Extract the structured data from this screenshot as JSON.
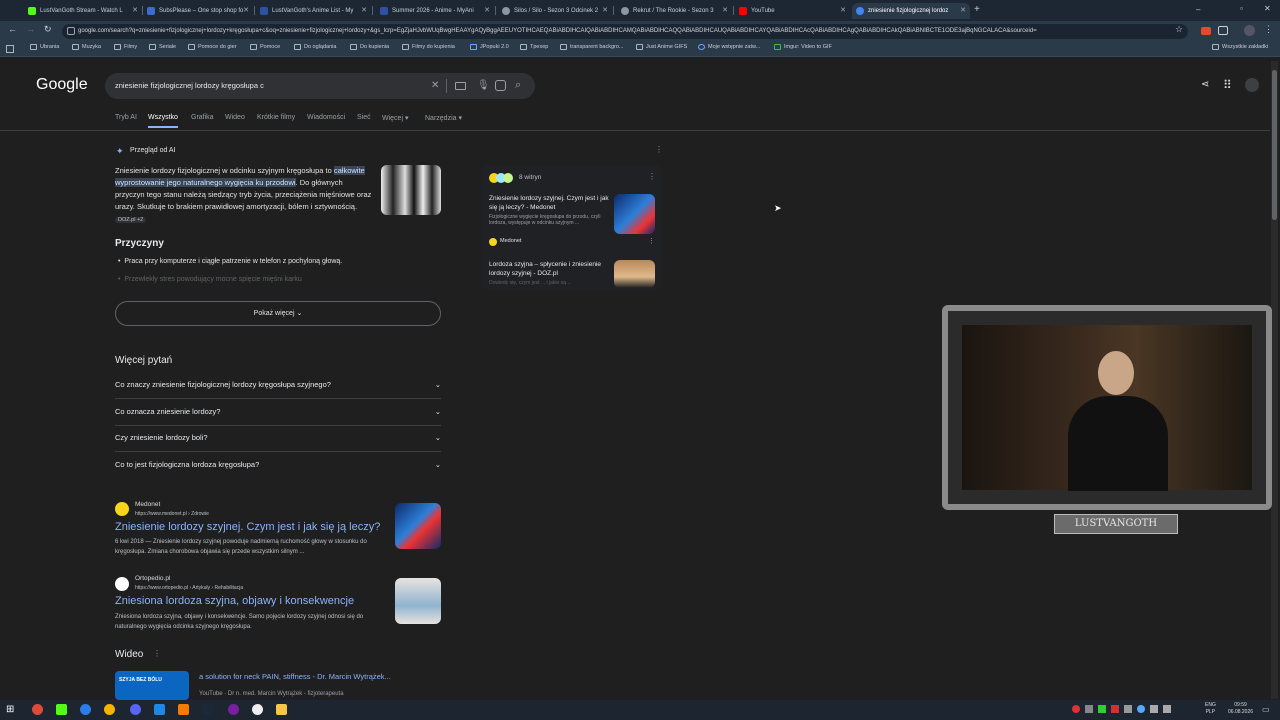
{
  "tabs": [
    {
      "label": "LustVanGoth Stream - Watch L",
      "color": "#53fc18"
    },
    {
      "label": "SubsPlease – One stop shop fo",
      "color": "#3f6bd1"
    },
    {
      "label": "LustVanGoth's Anime List - My",
      "color": "#2e51a2"
    },
    {
      "label": "Summer 2026 - Anime - MyAni",
      "color": "#2e51a2"
    },
    {
      "label": "Silos / Silo - Sezon 3 Odcinek 2",
      "color": "#8b96a5"
    },
    {
      "label": "Rekrut / The Rookie - Sezon 3",
      "color": "#8b96a5"
    },
    {
      "label": "YouTube",
      "color": "#ff0000"
    },
    {
      "label": "zniesienie fizjologicznej lordoz",
      "color": "#4285f4"
    }
  ],
  "address": "google.com/search?q=zniesienie+fizjologicznej+lordozy+kręgosłupa+c&oq=zniesienie+fizjologicznej+lordozy+&gs_lcrp=EgZjaHJvbWUqBwgHEAAYgAQyBggAEEUYOTIHCAEQABiABDIHCAIQABiABDIHCAMQABiABDIHCAQQABiABDIHCAUQABiABDIHCAYQABiABDIHCAcQABiABDIHCAgQABiABDIHCAkQABiABNIBCTE1ODE3ajBqNGCALACA&sourceid=",
  "bookmarks": [
    "Ubrania",
    "Muzyka",
    "Filmy",
    "Seriale",
    "Pomoce do gier",
    "Pomoce",
    "Do oglądania",
    "Do kupienia",
    "Filmy do kupienia",
    "JPopuki 2.0",
    "Tpexep",
    "transparent backgro...",
    "Just Anime GIFS",
    "Moje wstępnie zatw...",
    "Imgur: Video to GIF"
  ],
  "bookmarks_right": "Wszystkie zakładki",
  "google": {
    "logo": "Google",
    "query": "zniesienie fizjologicznej lordozy kręgosłupa c",
    "nav": [
      "Tryb AI",
      "Wszystko",
      "Grafika",
      "Wideo",
      "Krótkie filmy",
      "Wiadomości",
      "Sieć",
      "Więcej",
      "Narzędzia"
    ]
  },
  "ai": {
    "header": "Przegląd od AI",
    "p1_a": "Zniesienie lordozy fizjologicznej w odcinku szyjnym kręgosłupa to ",
    "p1_hl": "całkowite wyprostowanie jego naturalnego wygięcia ku przodowi",
    "p1_b": ". Do głównych przyczyn tego stanu należą siedzący tryb życia, przeciążenia mięśniowe oraz urazy. Skutkuje to brakiem prawidłowej amortyzacji, bólem i sztywnością.",
    "p1_src": "DOZ.pl +2",
    "causes_title": "Przyczyny",
    "cause1": "Praca przy komputerze i ciągłe patrzenie w telefon z pochyloną głową.",
    "cause2": "Przewlekły stres powodujący mocne spięcie mięśni karku",
    "show_more": "Pokaż więcej",
    "sites_count": "8 witryn",
    "card1_title": "Zniesienie lordozy szyjnej. Czym jest i jak się ją leczy? - Medonet",
    "card1_snip": "Fizjologiczne wygięcie kręgosłupa do przodu, czyli lordoza, występuje w odcinku szyjnym ...",
    "card1_site": "Medonet",
    "card2_title": "Lordoza szyjna – spłycenie i zniesienie lordozy szyjnej - DOZ.pl",
    "card2_snip": "Dowiedz się, czym jest ... i jakie są ..."
  },
  "paa": {
    "title": "Więcej pytań",
    "questions": [
      "Co znaczy zniesienie fizjologicznej lordozy kręgosłupa szyjnego?",
      "Co oznacza zniesienie lordozy?",
      "Czy zniesienie lordozy boli?",
      "Co to jest fizjologiczna lordoza kręgosłupa?"
    ]
  },
  "results": [
    {
      "site": "Medonet",
      "url": "https://www.medonet.pl › Zdrowie",
      "title": "Zniesienie lordozy szyjnej. Czym jest i jak się ją leczy?",
      "snippet": "6 kwi 2018 — Zniesienie lordozy szyjnej powoduje nadmierną ruchomość głowy w stosunku do kręgosłupa. Zmiana chorobowa objawia się przede wszystkim silnym ..."
    },
    {
      "site": "Ortopedio.pl",
      "url": "https://www.ortopedio.pl › Artykuły › Rehabilitacja",
      "title": "Zniesiona lordoza szyjna, objawy i konsekwencje",
      "snippet": "Zniesiona lordoza szyjna, objawy i konsekwencje. Samo pojęcie lordozy szyjnej odnosi się do naturalnego wygięcia odcinka szyjnego kręgosłupa."
    }
  ],
  "video": {
    "title": "Wideo",
    "item_title": "a solution for neck PAIN, stiffness - Dr. Marcin Wytrążek...",
    "item_meta": "YouTube · Dr n. med. Marcin Wytrążek - fizjoterapeuta",
    "thumb_text": "SZYJA BEZ BÓLU"
  },
  "webcam": {
    "label": "LUSTVANGOTH"
  },
  "tray": {
    "lang1": "ENG",
    "lang2": "PLP",
    "time": "09:59",
    "date": "06.08.2026"
  }
}
